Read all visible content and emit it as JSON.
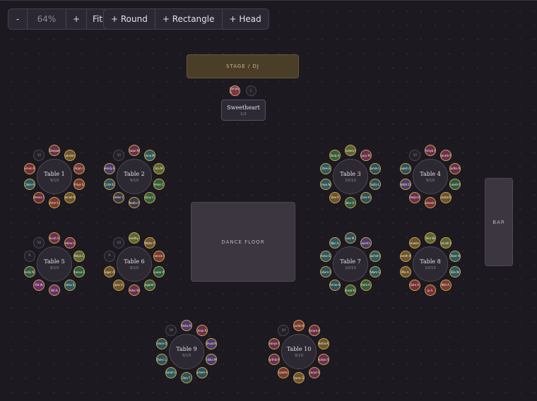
{
  "toolbar": {
    "zoom_out": "-",
    "zoom_level": "64%",
    "zoom_in": "+",
    "fit": "Fit",
    "add_round": "+ Round",
    "add_rectangle": "+ Rectangle",
    "add_head": "+ Head"
  },
  "zones": {
    "stage": "STAGE / DJ",
    "dance_floor": "DANCE FLOOR",
    "bar": "BAR"
  },
  "head_table": {
    "name": "Sweetheart",
    "count": "1/2",
    "seats": [
      {
        "label": "Sanjay S.",
        "color": "#7e3248"
      },
      {
        "label": "2",
        "color": ""
      }
    ]
  },
  "colors": {
    "seat_border": "#c9a64a",
    "stage": "#4a3e28",
    "background": "#1c1921"
  },
  "tables": [
    {
      "name": "Table 1",
      "count": "9/10",
      "seats": [
        {
          "label": "Deepak",
          "color": "#6b2f4a"
        },
        {
          "label": "Lakshmi",
          "color": "#6e5429"
        },
        {
          "label": "Arjun I.",
          "color": "#783b3b"
        },
        {
          "label": "Priya S.",
          "color": "#7a3a2e"
        },
        {
          "label": "Daniel W.",
          "color": "#6b5428"
        },
        {
          "label": "Amir S.",
          "color": "#7a3a2e"
        },
        {
          "label": "Meena T.",
          "color": "#6d2c3b"
        },
        {
          "label": "Claire A.",
          "color": "#2e5a5d"
        },
        {
          "label": "Simon R.",
          "color": "#763034"
        },
        {
          "label": "10",
          "color": ""
        }
      ]
    },
    {
      "name": "Table 2",
      "count": "9/10",
      "seats": [
        {
          "label": "Ewan M.",
          "color": "#6b2f4a"
        },
        {
          "label": "Fiona M.",
          "color": "#2e5a5d"
        },
        {
          "label": "Isla M.",
          "color": "#5c6632"
        },
        {
          "label": "Arnie C.",
          "color": "#355e3a"
        },
        {
          "label": "Vijay C.",
          "color": "#355e3a"
        },
        {
          "label": "Nadia F.",
          "color": "#3d3943"
        },
        {
          "label": "Helen C.",
          "color": "#3d3943"
        },
        {
          "label": "Colin B.",
          "color": "#2e5257"
        },
        {
          "label": "Wendy B.",
          "color": "#4d3b6b"
        },
        {
          "label": "10",
          "color": ""
        }
      ]
    },
    {
      "name": "Table 3",
      "count": "10/10",
      "seats": [
        {
          "label": "Naveen E.",
          "color": "#5c6632"
        },
        {
          "label": "Lucy M.",
          "color": "#6b2f4a"
        },
        {
          "label": "Jamie L.",
          "color": "#2e5257"
        },
        {
          "label": "Sofia L.",
          "color": "#2e5257"
        },
        {
          "label": "Zara H.",
          "color": "#2e5257"
        },
        {
          "label": "Ben O.",
          "color": "#2e5a3f"
        },
        {
          "label": "Dev P.",
          "color": "#6e5429"
        },
        {
          "label": "Freya N.",
          "color": "#2e5a5d"
        },
        {
          "label": "Chloe E.",
          "color": "#2e5a5d"
        },
        {
          "label": "Tariq A.",
          "color": "#355e3a"
        }
      ]
    },
    {
      "name": "Table 4",
      "count": "9/10",
      "seats": [
        {
          "label": "Shreya R.",
          "color": "#6b2f4a"
        },
        {
          "label": "Manish R.",
          "color": "#6b2f4a"
        },
        {
          "label": "Radha M.",
          "color": "#6b2f4a"
        },
        {
          "label": "Suresh M.",
          "color": "#2e5a3f"
        },
        {
          "label": "Geeta B.",
          "color": "#6e5429"
        },
        {
          "label": "Ramesh G.",
          "color": "#763034"
        },
        {
          "label": "Pooja D.",
          "color": "#6b2f4a"
        },
        {
          "label": "Nikhil D.",
          "color": "#4d3b6b"
        },
        {
          "label": "Rajesh G.",
          "color": "#2e5257"
        },
        {
          "label": "10",
          "color": ""
        }
      ]
    },
    {
      "name": "Table 5",
      "count": "8/10",
      "seats": [
        {
          "label": "Sunil O.",
          "color": "#6b2f4a"
        },
        {
          "label": "Rekha G.",
          "color": "#6b2f4a"
        },
        {
          "label": "Maya C.",
          "color": "#5c6632"
        },
        {
          "label": "Marcus B.",
          "color": "#2e5a3f"
        },
        {
          "label": "Elena S.",
          "color": "#2e5a5d"
        },
        {
          "label": "Siti H.",
          "color": "#6b2f6b"
        },
        {
          "label": "Pat W.",
          "color": "#6b2f6b"
        },
        {
          "label": "Holly N.",
          "color": "#2e5a3f"
        },
        {
          "label": "9",
          "color": ""
        },
        {
          "label": "10",
          "color": ""
        }
      ]
    },
    {
      "name": "Table 6",
      "count": "8/10",
      "seats": [
        {
          "label": "Dorothy P.",
          "color": "#5c6632"
        },
        {
          "label": "Walter P.",
          "color": "#6b5428"
        },
        {
          "label": "Frances W.",
          "color": "#7a3a2e"
        },
        {
          "label": "Louise W.",
          "color": "#2e5a3f"
        },
        {
          "label": "Margaret W.",
          "color": "#355e3a"
        },
        {
          "label": "Peter W.",
          "color": "#6b2f4a"
        },
        {
          "label": "Joan A.",
          "color": "#6e5429"
        },
        {
          "label": "Roger A.",
          "color": "#6e5429"
        },
        {
          "label": "9",
          "color": ""
        },
        {
          "label": "10",
          "color": ""
        }
      ]
    },
    {
      "name": "Table 7",
      "count": "10/10",
      "seats": [
        {
          "label": "Leo M.",
          "color": "#2e5257"
        },
        {
          "label": "Guest L.",
          "color": "#4d3b6b"
        },
        {
          "label": "Rachel G.",
          "color": "#2e5a5d"
        },
        {
          "label": "Adam G.",
          "color": "#2e5a5d"
        },
        {
          "label": "Femi A.",
          "color": "#355e3a"
        },
        {
          "label": "Yusuf K.",
          "color": "#355e3a"
        },
        {
          "label": "Amira K.",
          "color": "#2e5257"
        },
        {
          "label": "Callum R.",
          "color": "#2e5257"
        },
        {
          "label": "Hana S.",
          "color": "#2e5a5d"
        },
        {
          "label": "Nan S.",
          "color": "#2e5a5d"
        }
      ]
    },
    {
      "name": "Table 8",
      "count": "10/10",
      "seats": [
        {
          "label": "Tom W.",
          "color": "#5c6632"
        },
        {
          "label": "Hannah W.",
          "color": "#5c6632"
        },
        {
          "label": "Oliver W.",
          "color": "#2e5a5d"
        },
        {
          "label": "Ella W.",
          "color": "#2e5a5d"
        },
        {
          "label": "Neil A.",
          "color": "#7a3a2e"
        },
        {
          "label": "Jo A.",
          "color": "#763034"
        },
        {
          "label": "Sam A.",
          "color": "#763034"
        },
        {
          "label": "Mia A.",
          "color": "#6e5429"
        },
        {
          "label": "Gareth W.",
          "color": "#6e5429"
        },
        {
          "label": "Bronwen W.",
          "color": "#6e5429"
        }
      ]
    },
    {
      "name": "Table 9",
      "count": "9/10",
      "seats": [
        {
          "label": "Aisha R.",
          "color": "#4d3b6b"
        },
        {
          "label": "Omar R.",
          "color": "#6b2f4a"
        },
        {
          "label": "Divya K.",
          "color": "#4d3b6b"
        },
        {
          "label": "Ritika M.",
          "color": "#4d3b6b"
        },
        {
          "label": "Sameer M.",
          "color": "#2e5257"
        },
        {
          "label": "Bea T.",
          "color": "#2e5257"
        },
        {
          "label": "Sarah L.",
          "color": "#2e5a5d"
        },
        {
          "label": "Tanvi L.",
          "color": "#2e5257"
        },
        {
          "label": "Grace O.",
          "color": "#2e5257"
        },
        {
          "label": "10",
          "color": ""
        }
      ]
    },
    {
      "name": "Table 10",
      "count": "9/10",
      "seats": [
        {
          "label": "Sunita K.",
          "color": "#7a3a2e"
        },
        {
          "label": "Vikram K.",
          "color": "#6b2f4a"
        },
        {
          "label": "Nisha K.",
          "color": "#6e5429"
        },
        {
          "label": "Rohan S.",
          "color": "#6b2f4a"
        },
        {
          "label": "Kavya S.",
          "color": "#6b2f4a"
        },
        {
          "label": "Aarav S.",
          "color": "#6e5429"
        },
        {
          "label": "Priyanka N.",
          "color": "#7a3a2e"
        },
        {
          "label": "Karthik N.",
          "color": "#6b2f4a"
        },
        {
          "label": "Ananya N.",
          "color": "#6b2f4a"
        },
        {
          "label": "10",
          "color": ""
        }
      ]
    }
  ]
}
